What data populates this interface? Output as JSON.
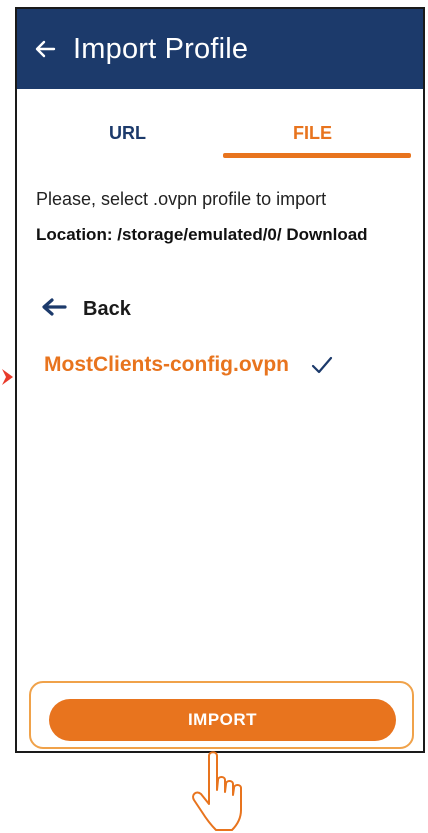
{
  "app": {
    "title": "Import Profile"
  },
  "tabs": [
    {
      "label": "URL",
      "active": false
    },
    {
      "label": "FILE",
      "active": true
    }
  ],
  "content": {
    "instruction": "Please, select .ovpn profile to import",
    "location": "Location: /storage/emulated/0/ Download",
    "back_label": "Back",
    "file_name": "MostClients-config.ovpn",
    "file_selected": true
  },
  "actions": {
    "import_label": "IMPORT"
  },
  "icons": {
    "header_back": "back-arrow-icon",
    "back_row": "arrow-left-icon",
    "selected": "check-icon",
    "annotation_pointer": "pointer-arrow-icon",
    "tap_hint": "hand-pointer-icon"
  },
  "colors": {
    "header_bg": "#1c3a6b",
    "accent": "#e8741e",
    "highlight_border": "#f0a24a",
    "text_dark": "#1a1a1a"
  }
}
